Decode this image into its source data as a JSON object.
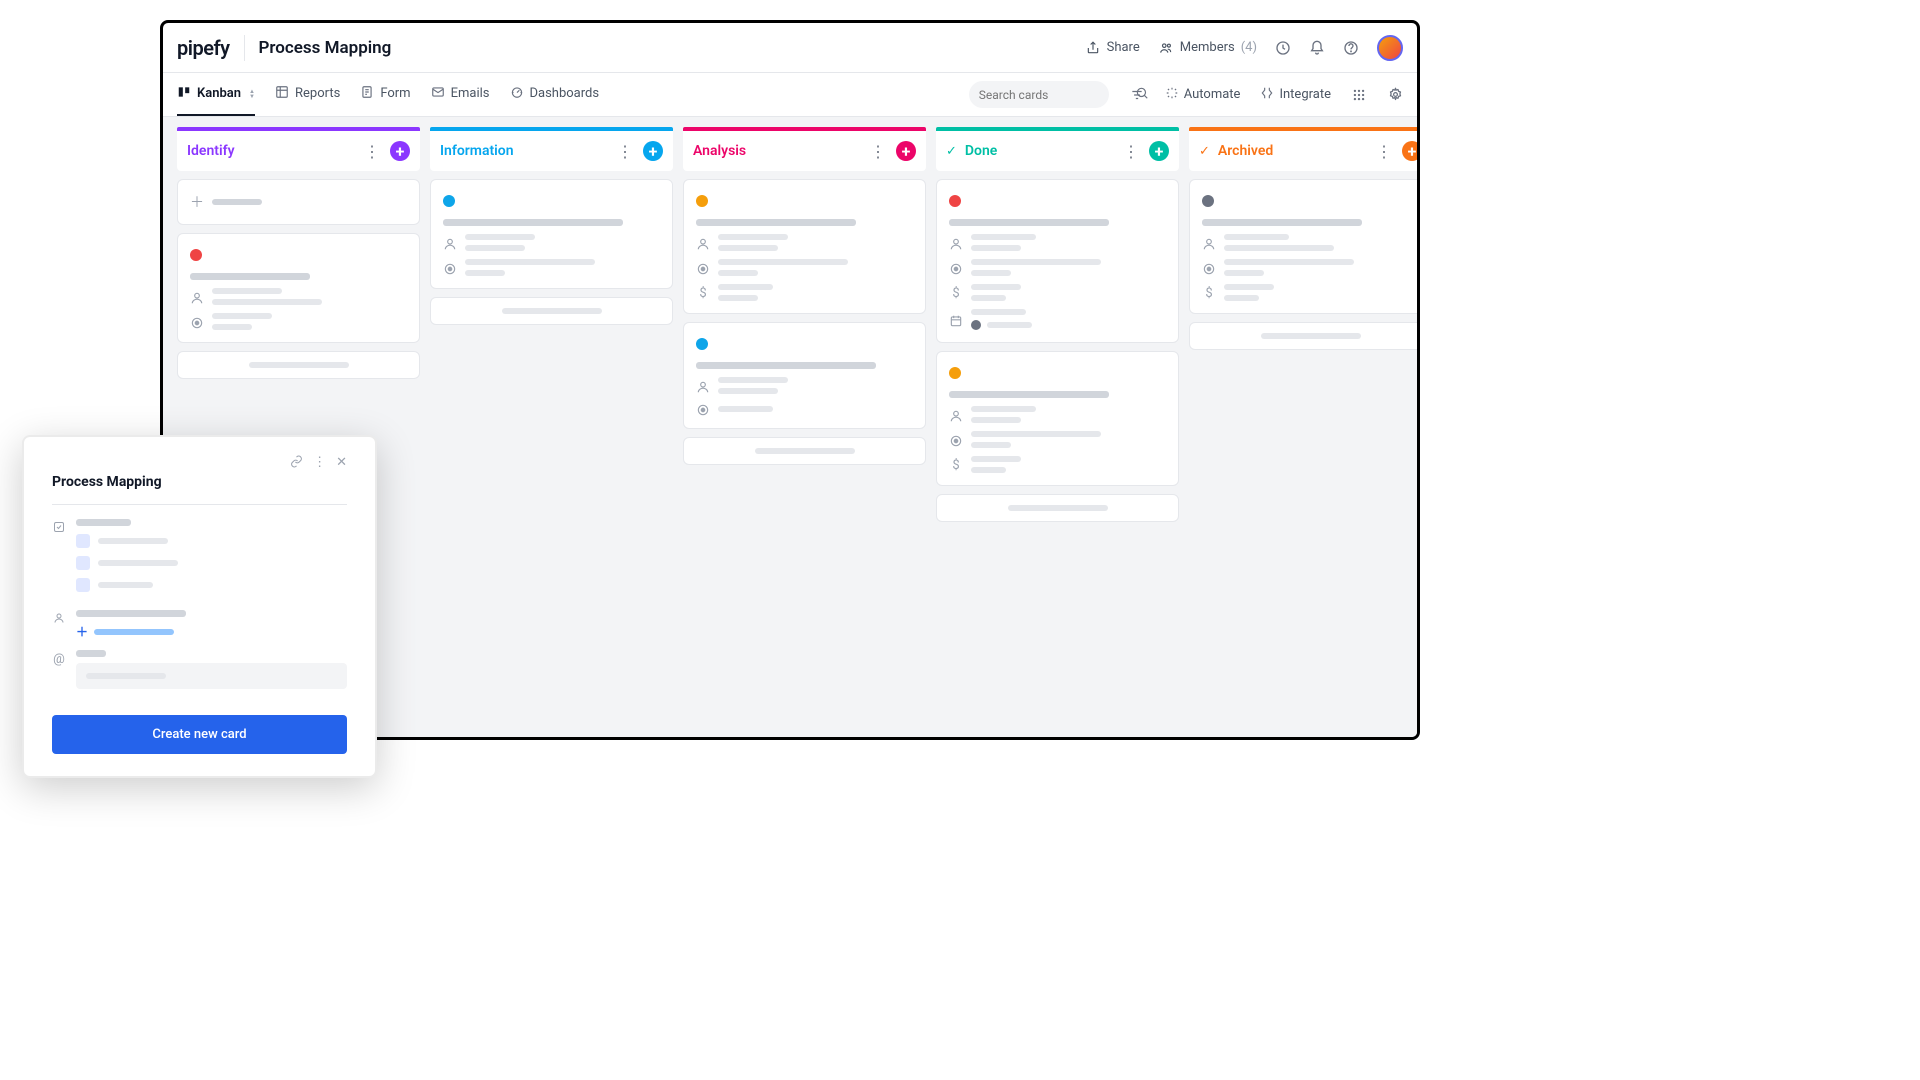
{
  "header": {
    "brand": "pipefy",
    "page_title": "Process Mapping",
    "share": "Share",
    "members": "Members",
    "members_count": "(4)"
  },
  "tabs": {
    "kanban": "Kanban",
    "reports": "Reports",
    "form": "Form",
    "emails": "Emails",
    "dashboards": "Dashboards"
  },
  "tools": {
    "search_placeholder": "Search cards",
    "automate": "Automate",
    "integrate": "Integrate"
  },
  "columns": [
    {
      "title": "Identify",
      "color": "#8b37ff",
      "add_color": "#8b37ff",
      "check": false
    },
    {
      "title": "Information",
      "color": "#06a6ee",
      "add_color": "#06a6ee",
      "check": false
    },
    {
      "title": "Analysis",
      "color": "#ec0569",
      "add_color": "#ec0569",
      "check": false
    },
    {
      "title": "Done",
      "color": "#00bfa5",
      "add_color": "#00bfa5",
      "check": true
    },
    {
      "title": "Archived",
      "color": "#f97316",
      "add_color": "#f97316",
      "check": true
    }
  ],
  "status_colors": {
    "red": "#ef4444",
    "blue": "#0ea5e9",
    "orange": "#f59e0b",
    "gray": "#6b7280"
  },
  "modal": {
    "title": "Process Mapping",
    "button": "Create new card"
  }
}
